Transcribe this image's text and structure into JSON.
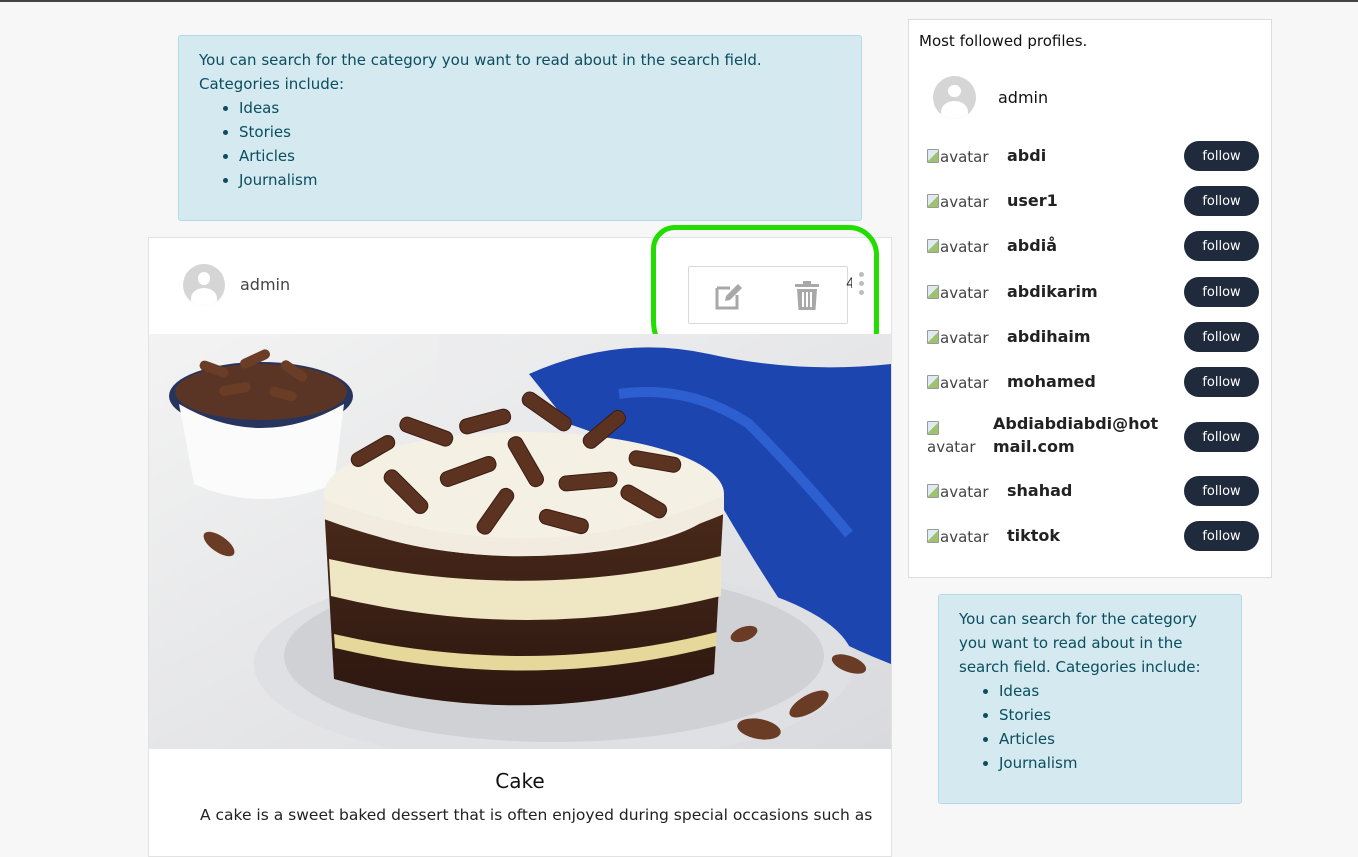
{
  "info_top": {
    "text": "You can search for the category you want to read about in the search field. Categories include:",
    "categories": [
      "Ideas",
      "Stories",
      "Articles",
      "Journalism"
    ]
  },
  "info_side": {
    "text": "You can search for the category you want to read about in the search field. Categories include:",
    "categories": [
      "Ideas",
      "Stories",
      "Articles",
      "Journalism"
    ]
  },
  "post": {
    "author": "admin",
    "truncated_digit": "4",
    "title": "Cake",
    "text": "A cake is a sweet baked dessert that is often enjoyed during special occasions such as",
    "edit_icon": "edit-icon",
    "delete_icon": "trash-icon",
    "menu_icon": "kebab-menu-icon"
  },
  "sidebar": {
    "title": "Most followed profiles.",
    "top_profile": "admin",
    "avatar_alt": "avatar",
    "follow_label": "follow",
    "profiles": [
      {
        "name": "abdi"
      },
      {
        "name": "user1"
      },
      {
        "name": "abdiå"
      },
      {
        "name": "abdikarim"
      },
      {
        "name": "abdihaim"
      },
      {
        "name": "mohamed"
      },
      {
        "name": "Abdiabdiabdi@hotmail.com"
      },
      {
        "name": "shahad"
      },
      {
        "name": "tiktok"
      }
    ]
  },
  "colors": {
    "info_bg": "#d5e9f0",
    "info_text": "#0a4e60",
    "follow_bg": "#1f2a3c",
    "highlight": "#22dd00"
  }
}
